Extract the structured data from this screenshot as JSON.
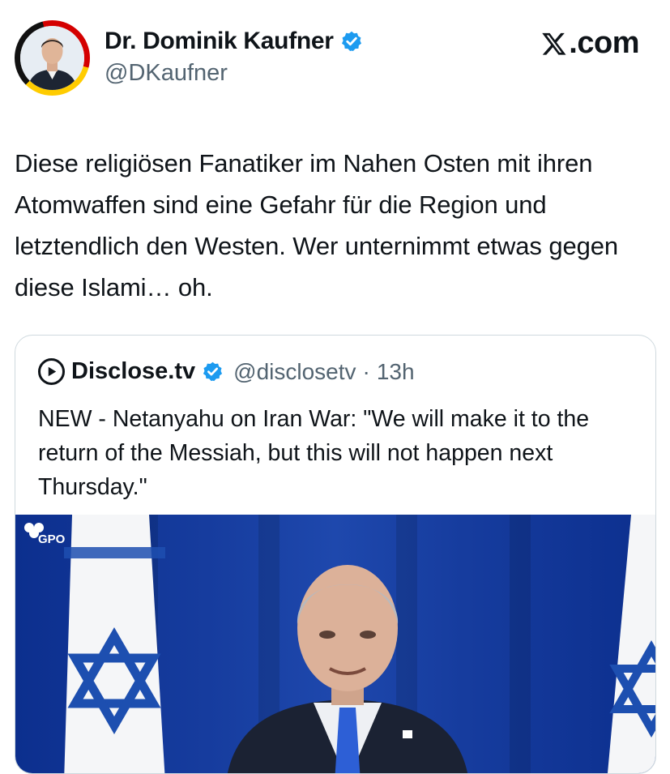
{
  "author": {
    "name": "Dr. Dominik Kaufner",
    "handle": "@DKaufner",
    "verified_icon": "verified-badge-icon",
    "avatar_ring_colors": [
      "#111111",
      "#d40000",
      "#ffcc00"
    ]
  },
  "platform": {
    "label": ".com",
    "logo_icon": "x-logo-icon"
  },
  "post": {
    "text": "Diese religiösen Fanatiker im Nahen Osten mit ihren Atomwaffen sind eine Gefahr für die Region und letztendlich den Westen. Wer unternimmt etwas gegen diese Islami… oh."
  },
  "quoted_post": {
    "name": "Disclose.tv",
    "handle": "@disclosetv",
    "separator": "·",
    "time": "13h",
    "text": "NEW - Netanyahu on Iran War: \"We will make it to the return of the Messiah, but this will not happen next Thursday.\"",
    "media": {
      "watermark": "GPO"
    }
  },
  "colors": {
    "verified_blue": "#1d9bf0",
    "secondary_text": "#536471",
    "flag_blue": "#1e48ad"
  }
}
